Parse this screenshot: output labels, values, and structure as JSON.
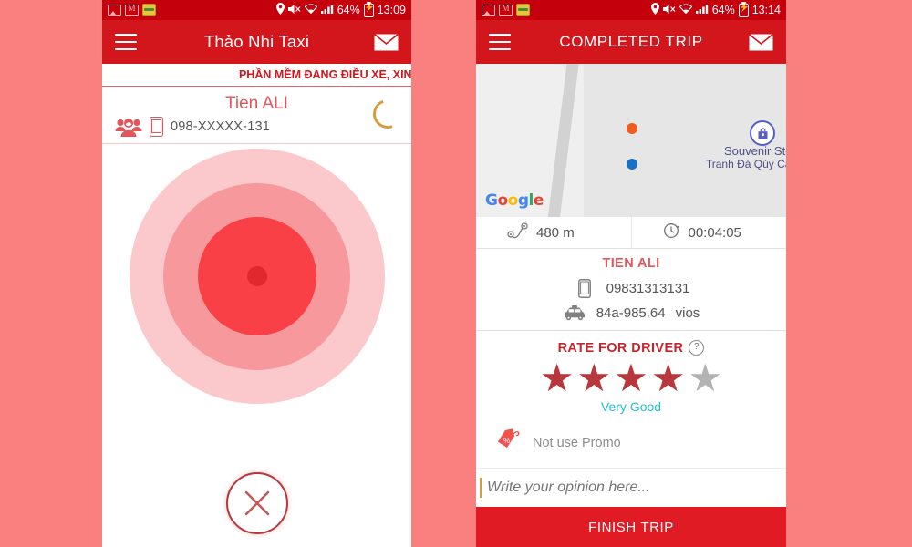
{
  "theme": {
    "background": "#f9807f",
    "statusbar_red": "#c4000c",
    "appbar_red": "#d3161c",
    "accent_red": "#e2565c",
    "finish_red": "#e01b24",
    "rate_label_blue": "#21c0d8",
    "star_on": "#b8373c",
    "star_off": "#b3b3b3",
    "spinner_gold": "#d79c3e"
  },
  "left_phone": {
    "statusbar": {
      "icons": [
        "image-icon",
        "gmail-icon",
        "app-icon"
      ],
      "location_icon": "location-pin-icon",
      "mute_icon": "mute-icon",
      "wifi_icon": "wifi-icon",
      "signal_icon": "signal-bars-icon",
      "battery_percent": "64%",
      "battery_icon": "battery-charging-icon",
      "time": "13:09"
    },
    "appbar": {
      "menu_icon": "hamburger-menu-icon",
      "title": "Thảo Nhi Taxi",
      "mail_icon": "envelope-icon"
    },
    "marquee": {
      "text": "PHẦN MỀM ĐANG ĐIỀU XE, XIN VUI L"
    },
    "passenger": {
      "group_icon": "group-people-icon",
      "name": "Tien ALI",
      "phone_icon": "mobile-phone-icon",
      "phone": "098-XXXXX-131",
      "spinner": "loading-spinner-icon"
    },
    "radar": {
      "rings": [
        "#fbc9cb",
        "#f7999c",
        "#f94046",
        "#e2282f"
      ]
    },
    "cancel_button": {
      "icon": "close-x-icon",
      "label": ""
    }
  },
  "right_phone": {
    "statusbar": {
      "icons": [
        "image-icon",
        "gmail-icon",
        "app-icon"
      ],
      "battery_percent": "64%",
      "time": "13:14"
    },
    "appbar": {
      "menu_icon": "hamburger-menu-icon",
      "title": "COMPLETED TRIP",
      "mail_icon": "envelope-icon"
    },
    "map": {
      "pickup_dot_color": "#ef5c1d",
      "dropoff_dot_color": "#1d71c4",
      "poi_icon": "shopping-bag-icon",
      "poi_name": "Souvenir Store",
      "poi_subtitle": "Tranh Đá Qúy Cao Linh",
      "attribution": "Google"
    },
    "stats": {
      "distance_icon": "route-icon",
      "distance": "480 m",
      "duration_icon": "clock-icon",
      "duration": "00:04:05"
    },
    "driver": {
      "name": "TIEN ALI",
      "phone_icon": "mobile-phone-icon",
      "phone": "09831313131",
      "car_icon": "taxi-car-icon",
      "plate": "84a-985.64",
      "model": "vios"
    },
    "rating": {
      "title": "RATE FOR DRIVER",
      "help_icon": "question-mark-icon",
      "help_label": "?",
      "max_stars": 5,
      "value": 4,
      "label": "Very Good"
    },
    "promo": {
      "icon": "promo-tag-icon",
      "text": "Not use Promo"
    },
    "opinion": {
      "value": "",
      "placeholder": "Write your opinion here..."
    },
    "finish_button": {
      "label": "FINISH TRIP"
    }
  }
}
